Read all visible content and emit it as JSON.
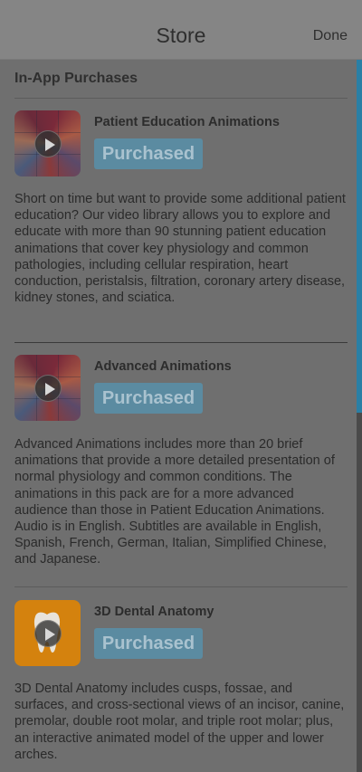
{
  "header": {
    "title": "Store",
    "done_label": "Done"
  },
  "section": {
    "title": "In-App Purchases"
  },
  "items": [
    {
      "title": "Patient Education Animations",
      "status": "Purchased",
      "description": "Short on time but want to provide some additional patient education? Our video library allows you to explore and educate with more than 90 stunning patient education animations that cover key physiology and common pathologies, including cellular respiration, heart conduction, peristalsis, filtration, coronary artery disease, kidney stones, and sciatica."
    },
    {
      "title": "Advanced Animations",
      "status": "Purchased",
      "description": "Advanced Animations includes more than 20 brief animations that provide a more detailed presentation of normal physiology and common conditions. The animations in this pack are for a more advanced audience than those in Patient Education Animations. Audio is in English. Subtitles are available in English, Spanish, French, German, Italian, Simplified Chinese, and Japanese."
    },
    {
      "title": "3D Dental Anatomy",
      "status": "Purchased",
      "description": "3D Dental Anatomy includes cusps, fossae, and surfaces, and cross-sectional views of an incisor, canine, premolar, double root molar, and triple root molar; plus, an interactive animated model of the upper and lower arches."
    }
  ],
  "icons": {
    "play": "play-icon",
    "tooth": "tooth-icon"
  },
  "colors": {
    "accent": "#2a7fa5",
    "badge": "#5b8ba1",
    "dental_tile": "#d4820e"
  }
}
